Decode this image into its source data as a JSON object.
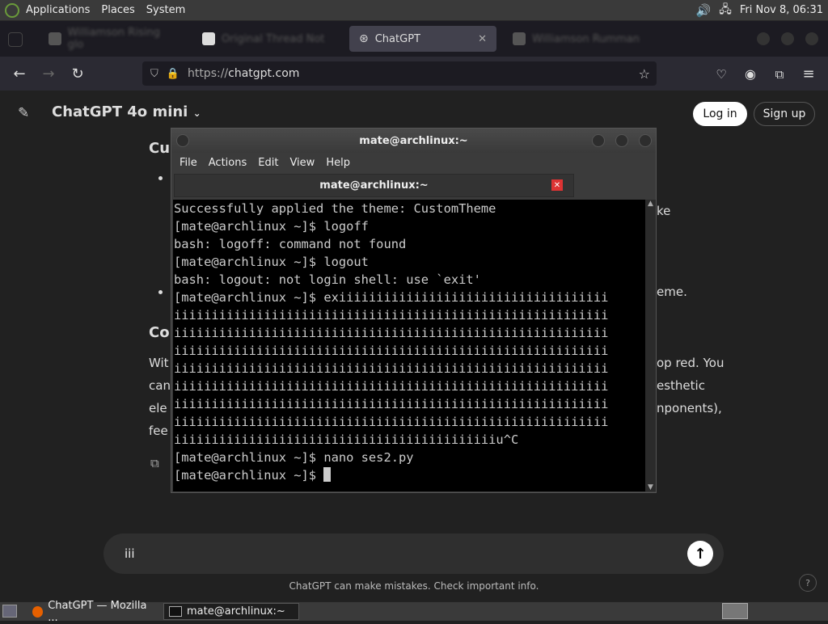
{
  "top_panel": {
    "menus": [
      "Applications",
      "Places",
      "System"
    ],
    "clock": "Fri Nov 8, 06:31"
  },
  "browser": {
    "tabs": [
      {
        "label": "Williamson Rising glo",
        "state": "blurred"
      },
      {
        "label": "Original Thread Not",
        "state": "blurred"
      },
      {
        "label": "ChatGPT",
        "state": "active"
      },
      {
        "label": "Williamson Rumman",
        "state": "blurred"
      }
    ],
    "url_protocol": "https://",
    "url_host": "chatgpt.com"
  },
  "chatgpt": {
    "model_title": "ChatGPT 4o mini",
    "login": "Log in",
    "signup": "Sign up",
    "heading_fragment": "Cu",
    "section_heading_fragment": "Co",
    "line_fragments": [
      "ke",
      "eme.",
      "Wit",
      "op red. You",
      "can",
      "esthetic",
      "ele",
      "nponents),",
      "fee"
    ],
    "composer_text": "iii",
    "disclaimer": "ChatGPT can make mistakes. Check important info.",
    "help": "?"
  },
  "terminal": {
    "window_title": "mate@archlinux:~",
    "menu": [
      "File",
      "Actions",
      "Edit",
      "View",
      "Help"
    ],
    "tab_title": "mate@archlinux:~",
    "lines": [
      "Successfully applied the theme: CustomTheme",
      "[mate@archlinux ~]$ logoff",
      "bash: logoff: command not found",
      "[mate@archlinux ~]$ logout",
      "bash: logout: not login shell: use `exit'",
      "[mate@archlinux ~]$ exiiiiiiiiiiiiiiiiiiiiiiiiiiiiiiiiiiii",
      "iiiiiiiiiiiiiiiiiiiiiiiiiiiiiiiiiiiiiiiiiiiiiiiiiiiiiiiiii",
      "iiiiiiiiiiiiiiiiiiiiiiiiiiiiiiiiiiiiiiiiiiiiiiiiiiiiiiiiii",
      "iiiiiiiiiiiiiiiiiiiiiiiiiiiiiiiiiiiiiiiiiiiiiiiiiiiiiiiiii",
      "iiiiiiiiiiiiiiiiiiiiiiiiiiiiiiiiiiiiiiiiiiiiiiiiiiiiiiiiii",
      "iiiiiiiiiiiiiiiiiiiiiiiiiiiiiiiiiiiiiiiiiiiiiiiiiiiiiiiiii",
      "iiiiiiiiiiiiiiiiiiiiiiiiiiiiiiiiiiiiiiiiiiiiiiiiiiiiiiiiii",
      "iiiiiiiiiiiiiiiiiiiiiiiiiiiiiiiiiiiiiiiiiiiiiiiiiiiiiiiiii",
      "iiiiiiiiiiiiiiiiiiiiiiiiiiiiiiiiiiiiiiiiiiiu^C",
      "[mate@archlinux ~]$ nano ses2.py",
      "[mate@archlinux ~]$ "
    ]
  },
  "taskbar": {
    "items": [
      {
        "label": "ChatGPT — Mozilla ...",
        "icon": "firefox-icon"
      },
      {
        "label": "mate@archlinux:~",
        "icon": "terminal-icon"
      }
    ]
  },
  "colors": {
    "page_bg": "#212121",
    "terminal_bg": "#000000",
    "panel_bg": "#3a3a3a"
  }
}
